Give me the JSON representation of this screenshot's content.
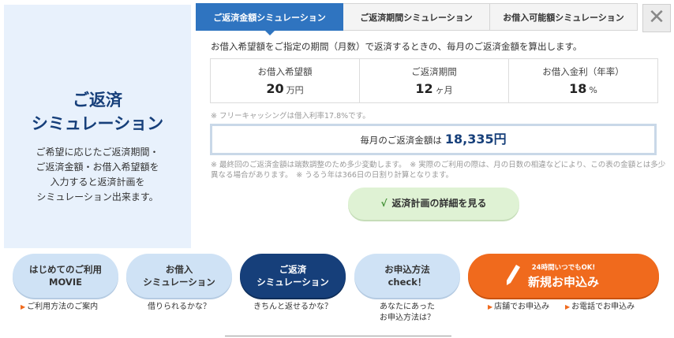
{
  "left": {
    "title_line1": "ご返済",
    "title_line2": "シミュレーション",
    "desc_line1": "ご希望に応じたご返済期間・",
    "desc_line2": "ご返済金額・お借入希望額を",
    "desc_line3": "入力すると返済計画を",
    "desc_line4": "シミュレーション出来ます。"
  },
  "tabs": [
    {
      "label": "ご返済金額シミュレーション",
      "active": true
    },
    {
      "label": "ご返済期間シミュレーション",
      "active": false
    },
    {
      "label": "お借入可能額シミュレーション",
      "active": false
    }
  ],
  "close_label": "✕",
  "intro": "お借入希望額をご指定の期間（月数）で返済するときの、毎月のご返済金額を算出します。",
  "inputs": {
    "amount": {
      "label": "お借入希望額",
      "value": "20",
      "unit": "万円"
    },
    "period": {
      "label": "ご返済期間",
      "value": "12",
      "unit": "ヶ月"
    },
    "rate": {
      "label": "お借入金利（年率）",
      "value": "18",
      "unit": "%"
    }
  },
  "note1": "※ フリーキャッシングは借入利率17.8%です。",
  "result": {
    "label": "毎月のご返済金額は",
    "value": "18,335円"
  },
  "note2": "※ 最終回のご返済金額は端数調整のため多少変動します。　※ 実際のご利用の際は、月の日数の相違などにより、この表の金額とは多少異なる場合があります。　※ うるう年は366日の日割り計算となります。",
  "detail_button": {
    "check": "√",
    "label": "返済計画の詳細を見る"
  },
  "nav": {
    "movie": {
      "line1": "はじめてのご利用",
      "line2": "MOVIE",
      "sub": "ご利用方法のご案内"
    },
    "borrow": {
      "line1": "お借入",
      "line2": "シミュレーション",
      "sub": "借りられるかな？"
    },
    "repay": {
      "line1": "ご返済",
      "line2": "シミュレーション",
      "sub": "きちんと返せるかな？"
    },
    "method": {
      "line1": "お申込方法",
      "line2": "check！",
      "sub_line1": "あなたにあった",
      "sub_line2": "お申込方法は？"
    },
    "apply": {
      "small": "24時間いつでもOK!",
      "big": "新規お申込み",
      "sub_store": "店舗でお申込み",
      "sub_phone": "お電話でお申込み"
    }
  },
  "colors": {
    "primary": "#2f74c0",
    "navy": "#163f7a",
    "orange": "#f06a1d",
    "light_blue": "#cfe2f5",
    "green": "#dff2d4"
  }
}
